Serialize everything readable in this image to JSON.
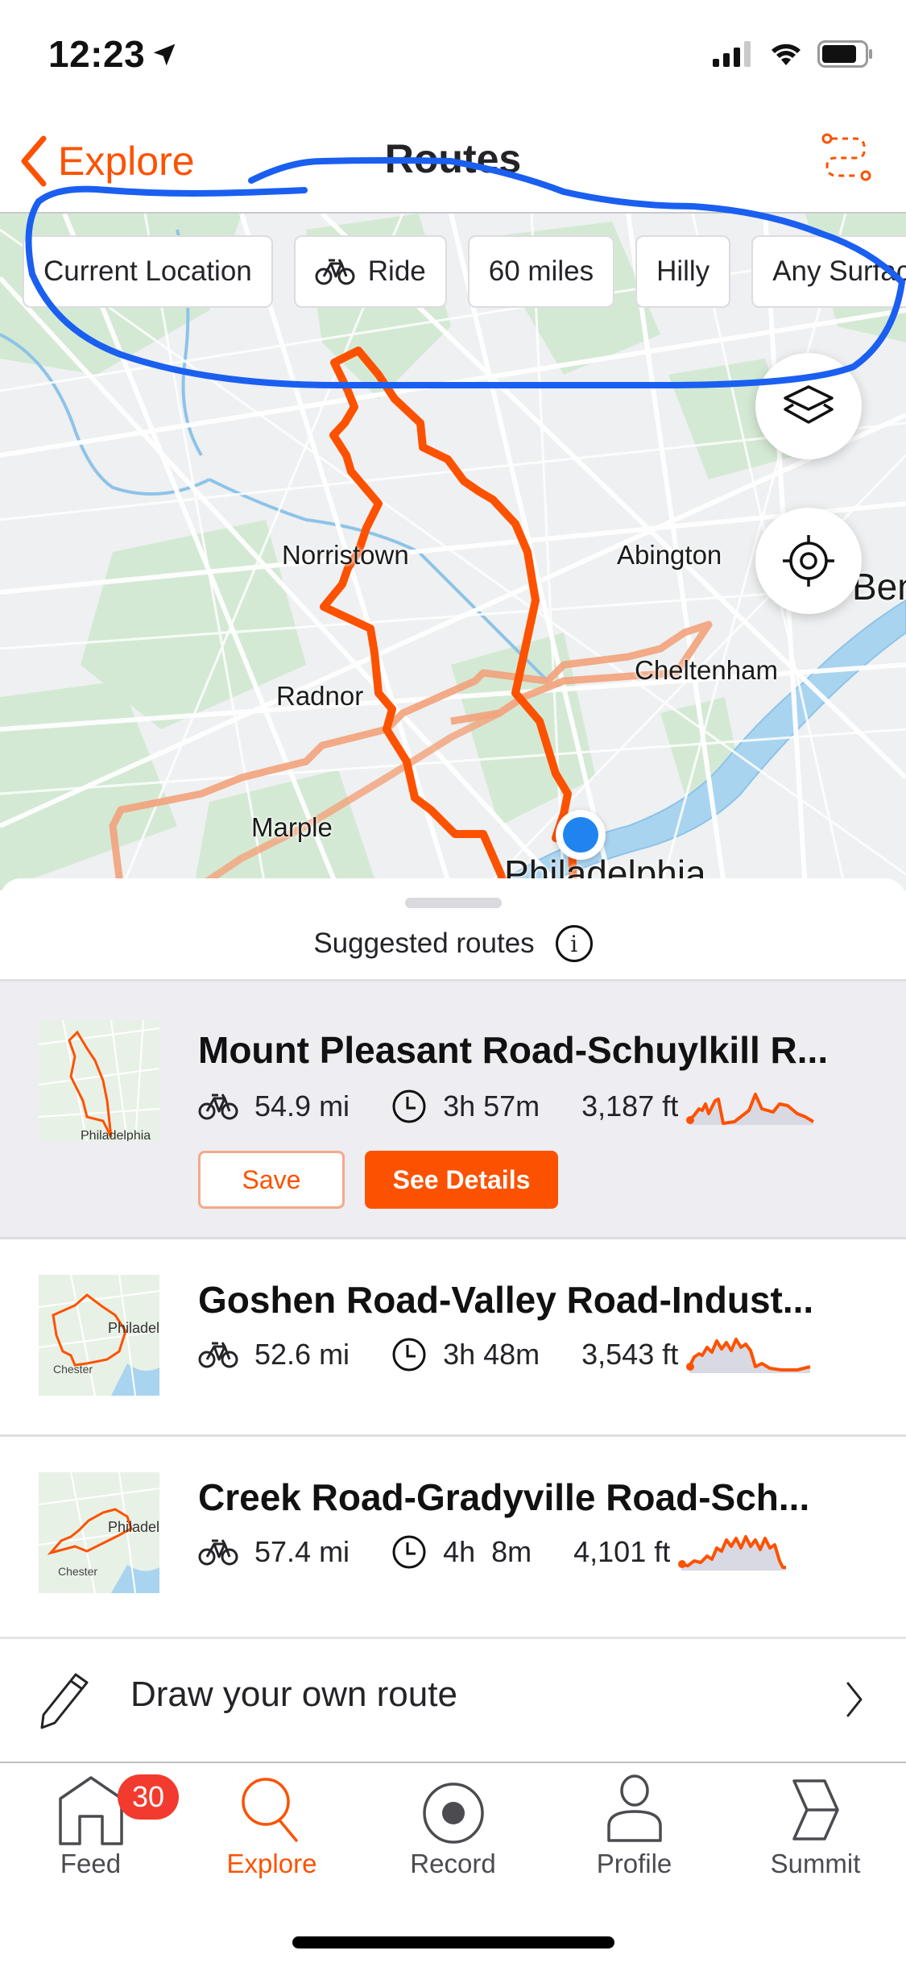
{
  "status_bar": {
    "time": "12:23",
    "icons": [
      "location-arrow-icon",
      "signal-icon",
      "wifi-icon",
      "battery-icon"
    ]
  },
  "nav": {
    "back_label": "Explore",
    "title": "Routes",
    "right_icon": "route-builder-icon"
  },
  "filters": [
    {
      "label": "Current Location",
      "icon": null
    },
    {
      "label": "Ride",
      "icon": "bike-icon"
    },
    {
      "label": "60 miles",
      "icon": null
    },
    {
      "label": "Hilly",
      "icon": null
    },
    {
      "label": "Any Surface",
      "icon": null
    }
  ],
  "map": {
    "labels": [
      "Norristown",
      "Abington",
      "Cheltenham",
      "Radnor",
      "Marple",
      "Philadelphia",
      "Bensalem"
    ],
    "buttons": [
      "layers-icon",
      "locate-me-icon"
    ],
    "route_color": "#fc5200",
    "location_color": "#1f84f0"
  },
  "sheet": {
    "title": "Suggested routes",
    "info_icon": "info-icon"
  },
  "routes": [
    {
      "name": "Mount Pleasant Road-Schuylkill R...",
      "distance": "54.9 mi",
      "time": "3h 57m",
      "elevation": "3,187 ft",
      "thumb_label": "Philadelphia",
      "selected": true,
      "save_label": "Save",
      "details_label": "See Details"
    },
    {
      "name": "Goshen Road-Valley Road-Indust...",
      "distance": "52.6 mi",
      "time": "3h 48m",
      "elevation": "3,543 ft",
      "thumb_label": "Philadelphia",
      "thumb_label2": "Chester",
      "selected": false
    },
    {
      "name": "Creek Road-Gradyville Road-Sch...",
      "distance": "57.4 mi",
      "time": "4h  8m",
      "elevation": "4,101 ft",
      "thumb_label": "Philadelphia",
      "thumb_label2": "Chester",
      "selected": false
    }
  ],
  "draw_route": {
    "label": "Draw your own route"
  },
  "tabs": [
    {
      "label": "Feed",
      "icon": "home-icon",
      "badge": "30",
      "active": false
    },
    {
      "label": "Explore",
      "icon": "search-icon",
      "active": true
    },
    {
      "label": "Record",
      "icon": "record-icon",
      "active": false
    },
    {
      "label": "Profile",
      "icon": "profile-icon",
      "active": false
    },
    {
      "label": "Summit",
      "icon": "summit-icon",
      "active": false
    }
  ],
  "colors": {
    "accent": "#fc5200",
    "badge": "#f23b2e",
    "annotation": "#1a5ff0"
  }
}
